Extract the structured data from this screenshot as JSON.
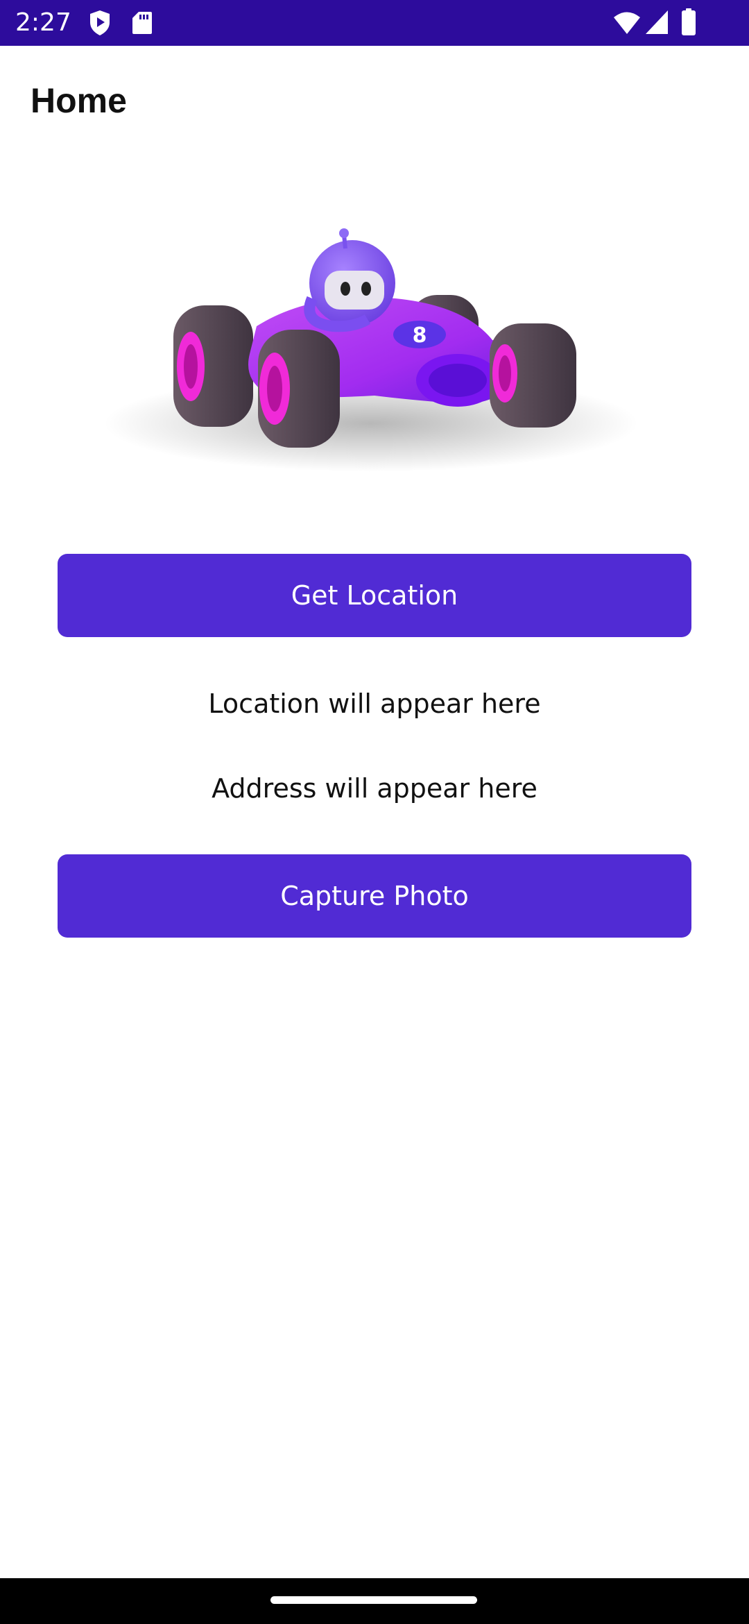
{
  "status_bar": {
    "time": "2:27",
    "background": "#2d0c9c",
    "left_icons": [
      "play-protect-icon",
      "sd-card-icon"
    ],
    "right_icons": [
      "wifi-icon",
      "signal-icon",
      "battery-icon"
    ]
  },
  "header": {
    "title": "Home"
  },
  "hero": {
    "icon": "race-car-bot-illustration"
  },
  "actions": {
    "get_location_label": "Get Location",
    "capture_photo_label": "Capture Photo",
    "button_color": "#512bd4"
  },
  "info": {
    "location_text": "Location will appear here",
    "address_text": "Address will appear here"
  }
}
